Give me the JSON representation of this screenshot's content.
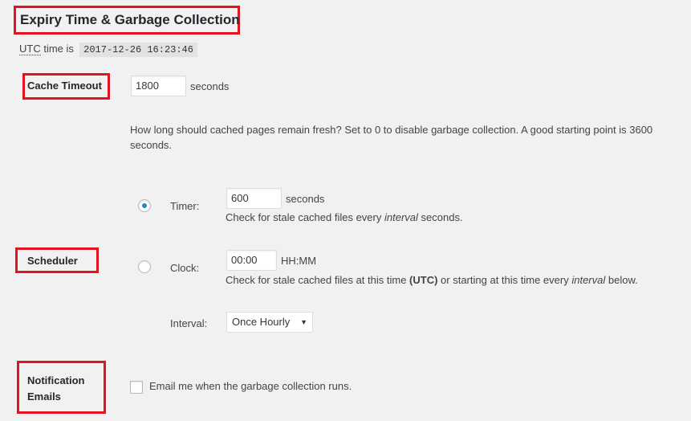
{
  "section": {
    "title": "Expiry Time & Garbage Collection",
    "utc_abbr": "UTC",
    "utc_prefix_rest": " time is ",
    "utc_time": "2017-12-26 16:23:46"
  },
  "cache_timeout": {
    "label": "Cache Timeout",
    "value": "1800",
    "unit": "seconds",
    "description": "How long should cached pages remain fresh? Set to 0 to disable garbage collection. A good starting point is 3600 seconds."
  },
  "scheduler": {
    "label": "Scheduler",
    "timer": {
      "label": "Timer:",
      "selected": true,
      "value": "600",
      "unit": "seconds",
      "desc_before": "Check for stale cached files every ",
      "desc_em": "interval",
      "desc_after": " seconds."
    },
    "clock": {
      "label": "Clock:",
      "selected": false,
      "value": "00:00",
      "unit": "HH:MM",
      "desc_before": "Check for stale cached files at this time ",
      "desc_strong": "(UTC)",
      "desc_middle": " or starting at this time every ",
      "desc_em": "interval",
      "desc_after": " below."
    },
    "interval": {
      "label": "Interval:",
      "selected_option": "Once Hourly"
    }
  },
  "notification_emails": {
    "label_line1": "Notification",
    "label_line2": "Emails",
    "checkbox_label": "Email me when the garbage collection runs.",
    "checked": false
  },
  "colors": {
    "highlight_box": "#e3131f",
    "radio_selected": "#1e8cbe",
    "background": "#f1f1f1"
  }
}
